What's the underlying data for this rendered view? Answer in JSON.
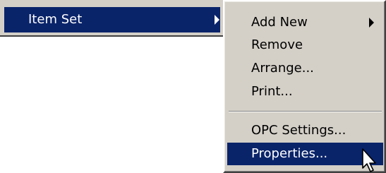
{
  "parent_menu": {
    "item_set": {
      "label": "Item Set",
      "icon": "chevron-right-icon"
    }
  },
  "submenu": {
    "items": [
      {
        "label": "Add New",
        "has_submenu": true,
        "icon": "chevron-right-icon"
      },
      {
        "label": "Remove"
      },
      {
        "label": "Arrange..."
      },
      {
        "label": "Print..."
      },
      {
        "label": "OPC Settings..."
      },
      {
        "label": "Properties...",
        "selected": true
      }
    ]
  },
  "cursor": {
    "icon": "arrow-cursor-icon"
  },
  "colors": {
    "menu_background": "#d4d0c8",
    "selection_background": "#0a246a",
    "selection_text": "#ffffff",
    "text": "#000000"
  }
}
